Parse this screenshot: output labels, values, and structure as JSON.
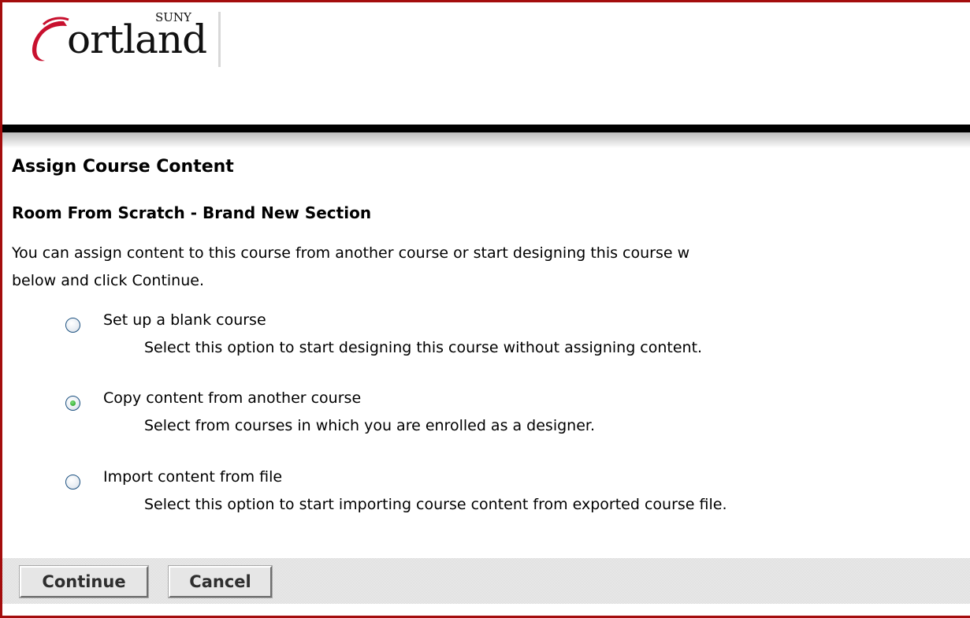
{
  "logo": {
    "brand": "Cortland",
    "suny": "SUNY",
    "brand_rest": "ortland",
    "accent": "#c8102e"
  },
  "page": {
    "title": "Assign Course Content",
    "section_title": "Room From Scratch - Brand New Section",
    "intro_line1": "You can assign content to this course from another course or start designing this course w",
    "intro_line2": "below and click Continue."
  },
  "options": [
    {
      "label": "Set up a blank course",
      "description": "Select this option to start designing this course without assigning content.",
      "selected": false
    },
    {
      "label": "Copy content from another course",
      "description": "Select from courses in which you are enrolled as a designer.",
      "selected": true
    },
    {
      "label": "Import content from file",
      "description": "Select this option to start importing course content from exported course file.",
      "selected": false
    }
  ],
  "buttons": {
    "continue_label": "Continue",
    "cancel_label": "Cancel"
  },
  "colors": {
    "frame_border": "#a40d0d",
    "header_bar": "#000000",
    "radio_selected": "#1b9a1b"
  }
}
